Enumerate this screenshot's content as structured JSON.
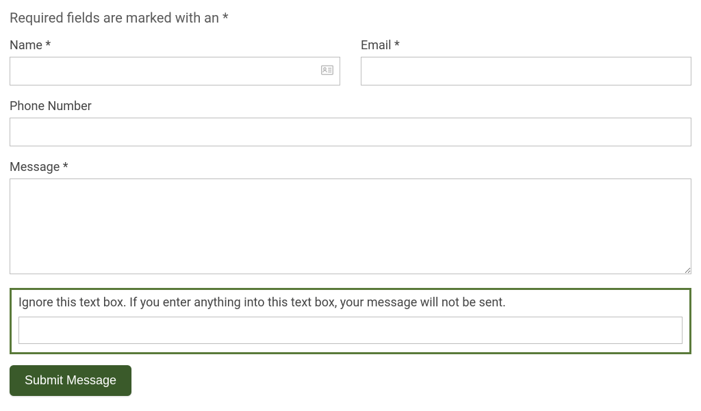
{
  "form": {
    "required_note": "Required fields are marked with an *",
    "name": {
      "label": "Name *",
      "value": ""
    },
    "email": {
      "label": "Email *",
      "value": ""
    },
    "phone": {
      "label": "Phone Number",
      "value": ""
    },
    "message": {
      "label": "Message *",
      "value": ""
    },
    "honeypot": {
      "instruction": "Ignore this text box. If you enter anything into this text box, your message will not be sent.",
      "value": ""
    },
    "submit_label": "Submit Message"
  }
}
